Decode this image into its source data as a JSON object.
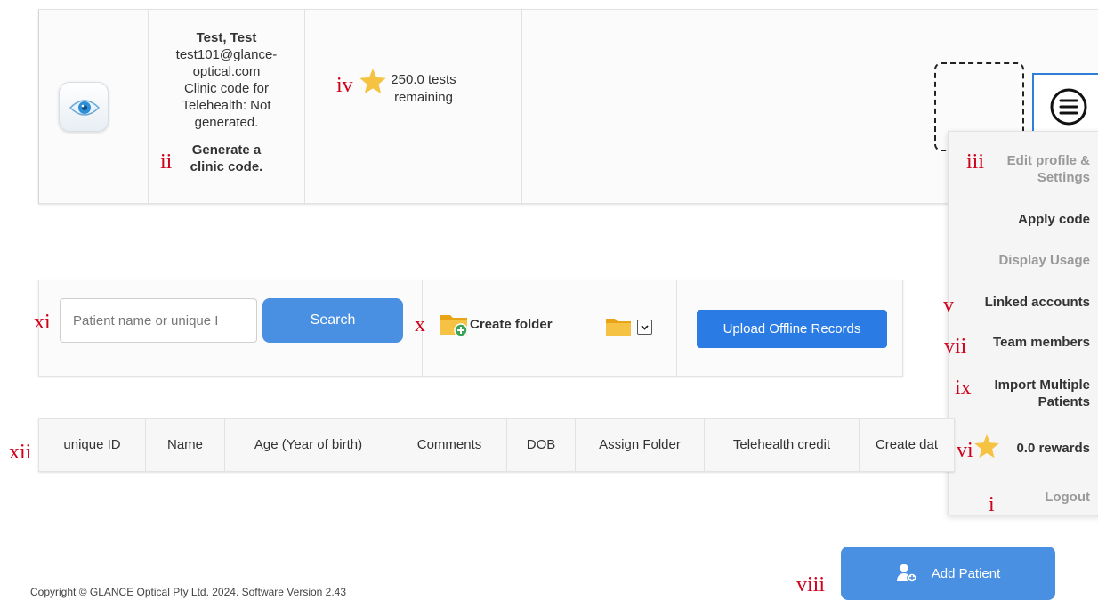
{
  "user": {
    "name": "Test, Test",
    "email_line1": "test101@glance-",
    "email_line2": "optical.com",
    "clinic_line1": "Clinic code for",
    "clinic_line2": "Telehealth: Not",
    "clinic_line3": "generated.",
    "generate_line1": "Generate a",
    "generate_line2": "clinic code."
  },
  "tests": {
    "line1": "250.0 tests",
    "line2": "remaining"
  },
  "menu": {
    "items": [
      {
        "line1": "Edit profile &",
        "line2": "Settings"
      },
      {
        "label": "Apply code"
      },
      {
        "label": "Display Usage"
      },
      {
        "label": "Linked accounts"
      },
      {
        "label": "Team members"
      },
      {
        "line1": "Import Multiple",
        "line2": "Patients"
      },
      {
        "label": "0.0 rewards"
      },
      {
        "label": "Logout"
      }
    ]
  },
  "search": {
    "placeholder": "Patient name or unique I",
    "button": "Search"
  },
  "toolbar": {
    "create_folder": "Create folder",
    "upload": "Upload Offline Records"
  },
  "table": {
    "columns": [
      "unique ID",
      "Name",
      "Age (Year of birth)",
      "Comments",
      "DOB",
      "Assign Folder",
      "Telehealth credit",
      "Create dat"
    ]
  },
  "add_patient": "Add Patient",
  "footer": "Copyright © GLANCE Optical Pty Ltd. 2024. Software Version 2.43",
  "markers": {
    "i": "i",
    "ii": "ii",
    "iii": "iii",
    "iv": "iv",
    "v": "v",
    "vi": "vi",
    "vii": "vii",
    "viii": "viii",
    "ix": "ix",
    "x": "x",
    "xi": "xi",
    "xii": "xii"
  },
  "colors": {
    "accent": "#4a90e2",
    "upload": "#2a7be4",
    "marker": "#d0021b",
    "star": "#f5c242"
  }
}
